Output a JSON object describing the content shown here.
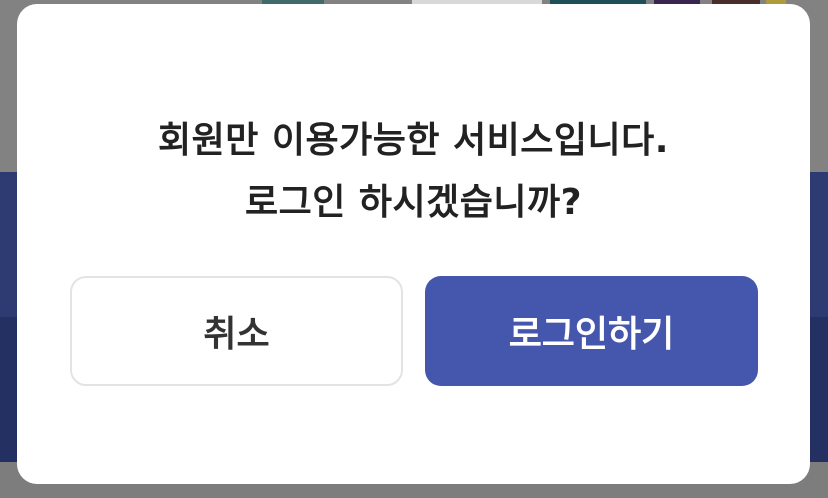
{
  "dialog": {
    "message_line1": "회원만 이용가능한 서비스입니다.",
    "message_line2": "로그인 하시겠습니까?",
    "cancel_label": "취소",
    "login_label": "로그인하기"
  },
  "colors": {
    "primary": "#4457ad",
    "overlay_band": "#2e3a72",
    "text": "#222222"
  }
}
